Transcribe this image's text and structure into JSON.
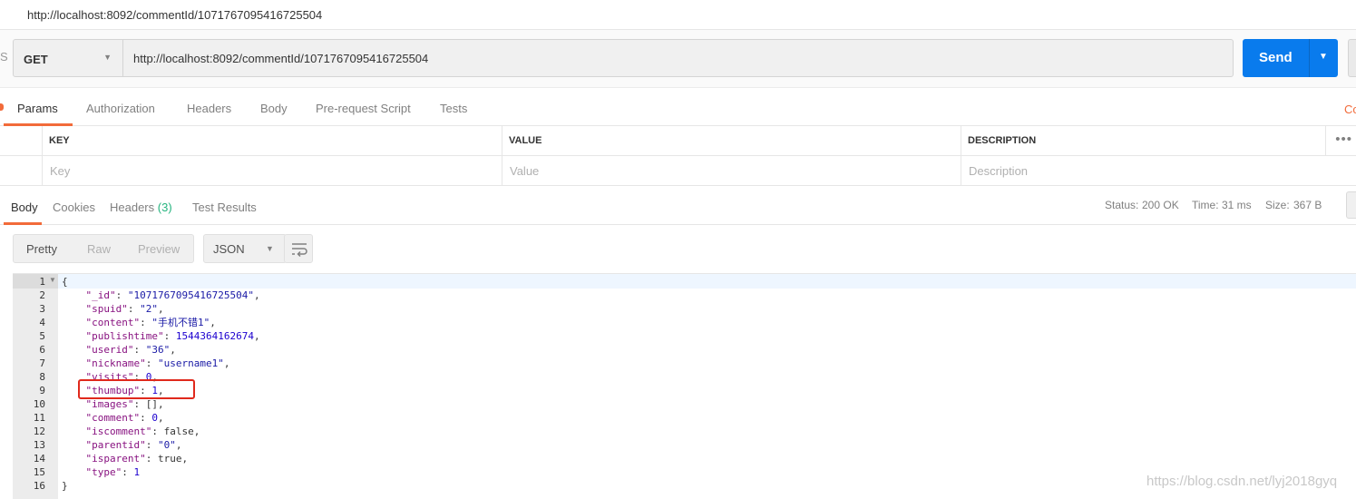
{
  "window": {
    "tab_title": "http://localhost:8092/commentId/1071767095416725504"
  },
  "request": {
    "left_edge_text": "S",
    "method": "GET",
    "url": "http://localhost:8092/commentId/1071767095416725504",
    "send_label": "Send"
  },
  "request_tabs": {
    "items": [
      "Params",
      "Authorization",
      "Headers",
      "Body",
      "Pre-request Script",
      "Tests"
    ],
    "active": "Params",
    "right_edge_text": "Co"
  },
  "params_table": {
    "headers": [
      "KEY",
      "VALUE",
      "DESCRIPTION"
    ],
    "placeholders": [
      "Key",
      "Value",
      "Description"
    ],
    "more_glyph": "•••"
  },
  "response_tabs": {
    "body": "Body",
    "cookies": "Cookies",
    "headers": "Headers",
    "headers_count": "(3)",
    "test_results": "Test Results",
    "active": "Body"
  },
  "response_status": {
    "status_label": "Status:",
    "status_value": "200 OK",
    "time_label": "Time:",
    "time_value": "31 ms",
    "size_label": "Size:",
    "size_value": "367 B"
  },
  "format_bar": {
    "pretty": "Pretty",
    "raw": "Raw",
    "preview": "Preview",
    "type": "JSON",
    "accent_color": "#f26b3a"
  },
  "code_lines": [
    {
      "n": "1",
      "t": "{"
    },
    {
      "n": "2",
      "key": "\"_id\"",
      "val": "\"1071767095416725504\"",
      "vt": "s"
    },
    {
      "n": "3",
      "key": "\"spuid\"",
      "val": "\"2\"",
      "vt": "s"
    },
    {
      "n": "4",
      "key": "\"content\"",
      "val": "\"手机不错1\"",
      "vt": "s"
    },
    {
      "n": "5",
      "key": "\"publishtime\"",
      "val": "1544364162674",
      "vt": "n"
    },
    {
      "n": "6",
      "key": "\"userid\"",
      "val": "\"36\"",
      "vt": "s"
    },
    {
      "n": "7",
      "key": "\"nickname\"",
      "val": "\"username1\"",
      "vt": "s"
    },
    {
      "n": "8",
      "key": "\"visits\"",
      "val": "0",
      "vt": "n"
    },
    {
      "n": "9",
      "key": "\"thumbup\"",
      "val": "1",
      "vt": "n"
    },
    {
      "n": "10",
      "key": "\"images\"",
      "val": "[]",
      "vt": "b"
    },
    {
      "n": "11",
      "key": "\"comment\"",
      "val": "0",
      "vt": "n"
    },
    {
      "n": "12",
      "key": "\"iscomment\"",
      "val": "false",
      "vt": "b"
    },
    {
      "n": "13",
      "key": "\"parentid\"",
      "val": "\"0\"",
      "vt": "s"
    },
    {
      "n": "14",
      "key": "\"isparent\"",
      "val": "true",
      "vt": "b"
    },
    {
      "n": "15",
      "key": "\"type\"",
      "val": "1",
      "vt": "n",
      "last": true
    },
    {
      "n": "16",
      "t": "}"
    }
  ],
  "watermark": "https://blog.csdn.net/lyj2018gyq",
  "colors": {
    "send": "#097bed",
    "status_ok": "#26b47f",
    "highlight": "#e0291c"
  }
}
